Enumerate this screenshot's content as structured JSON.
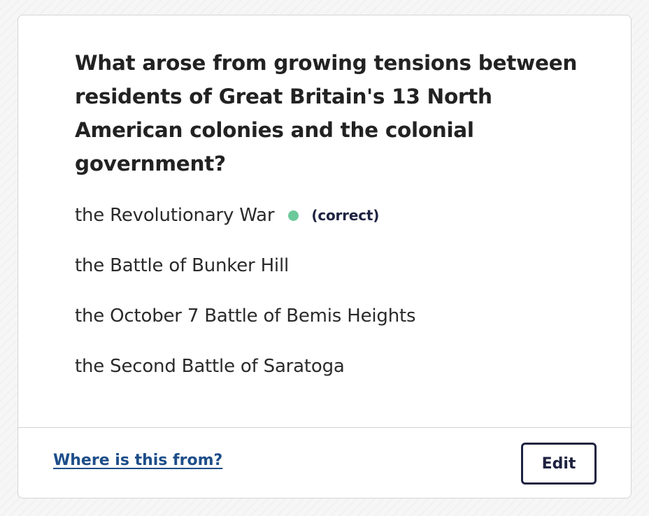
{
  "question": {
    "text": "What arose from growing tensions between residents of Great Britain's 13 North American colonies and the colonial government?"
  },
  "answers": [
    {
      "text": "the Revolutionary War",
      "correct_label": "(correct)"
    },
    {
      "text": "the Battle of Bunker Hill"
    },
    {
      "text": "the October 7 Battle of Bemis Heights"
    },
    {
      "text": "the Second Battle of Saratoga"
    }
  ],
  "footer": {
    "source_link": "Where is this from?",
    "edit_label": "Edit"
  },
  "colors": {
    "correct_dot": "#6bc99a",
    "link": "#1d4e89",
    "button_border": "#1e2240"
  }
}
